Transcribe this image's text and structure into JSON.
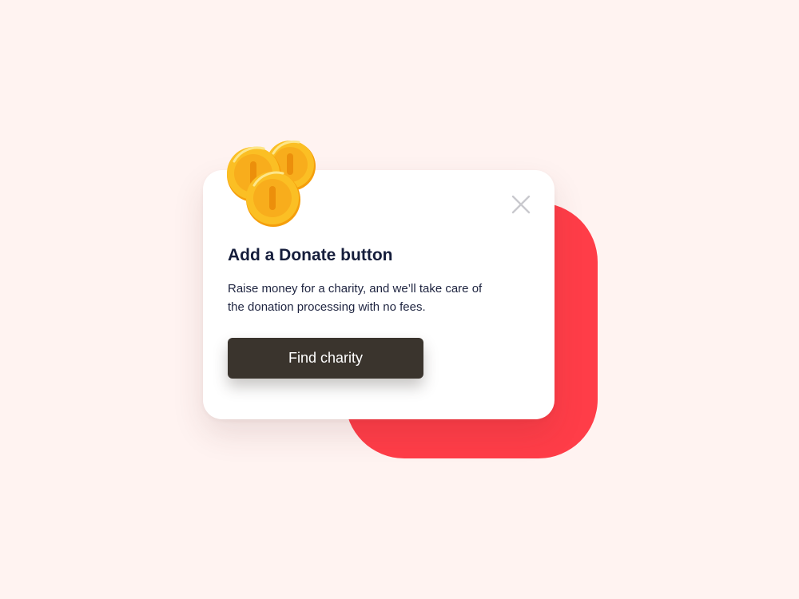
{
  "dialog": {
    "title": "Add a Donate button",
    "description": "Raise money for a charity, and we’ll take care of the donation processing with no fees.",
    "cta_label": "Find charity",
    "close_icon": "close-icon",
    "decoration_icon": "gold-coins-icon"
  },
  "colors": {
    "background": "#fff3f1",
    "accent": "#ff3d48",
    "button": "#3a342d",
    "title": "#151d3b",
    "coin": "#fbbf24"
  }
}
